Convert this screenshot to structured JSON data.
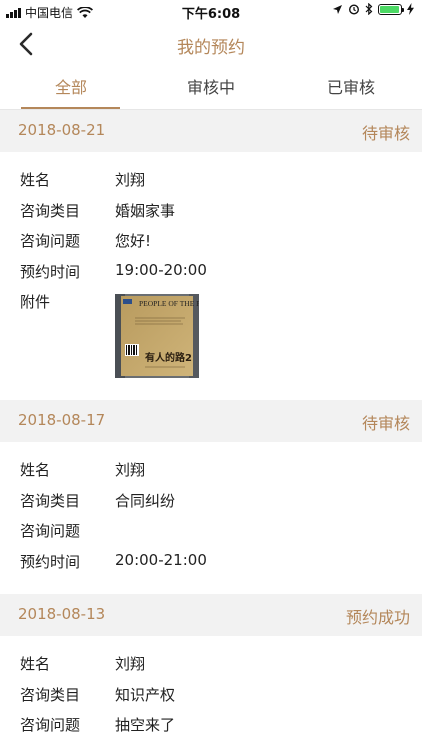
{
  "status_bar": {
    "carrier": "中国电信",
    "time": "下午6:08",
    "battery_color": "#4cd964"
  },
  "nav": {
    "title": "我的预约",
    "back_icon": "chevron-left-icon"
  },
  "tabs": [
    {
      "label": "全部",
      "active": true
    },
    {
      "label": "审核中",
      "active": false
    },
    {
      "label": "已审核",
      "active": false
    }
  ],
  "field_labels": {
    "name": "姓名",
    "category": "咨询类目",
    "question": "咨询问题",
    "time": "预约时间",
    "attachment": "附件"
  },
  "appointments": [
    {
      "date": "2018-08-21",
      "status": "待审核",
      "name": "刘翔",
      "category": "婚姻家事",
      "question": "您好!",
      "time": "19:00-20:00",
      "attachment": {
        "cover_title": "PEOPLE OF THE PLAIN",
        "cover_text": "有人的路2"
      }
    },
    {
      "date": "2018-08-17",
      "status": "待审核",
      "name": "刘翔",
      "category": "合同纠纷",
      "question": "",
      "time": "20:00-21:00"
    },
    {
      "date": "2018-08-13",
      "status": "预约成功",
      "name": "刘翔",
      "category": "知识产权",
      "question": "抽空来了"
    }
  ],
  "colors": {
    "accent": "#b4875a",
    "section_bg": "#f2f2f2"
  }
}
